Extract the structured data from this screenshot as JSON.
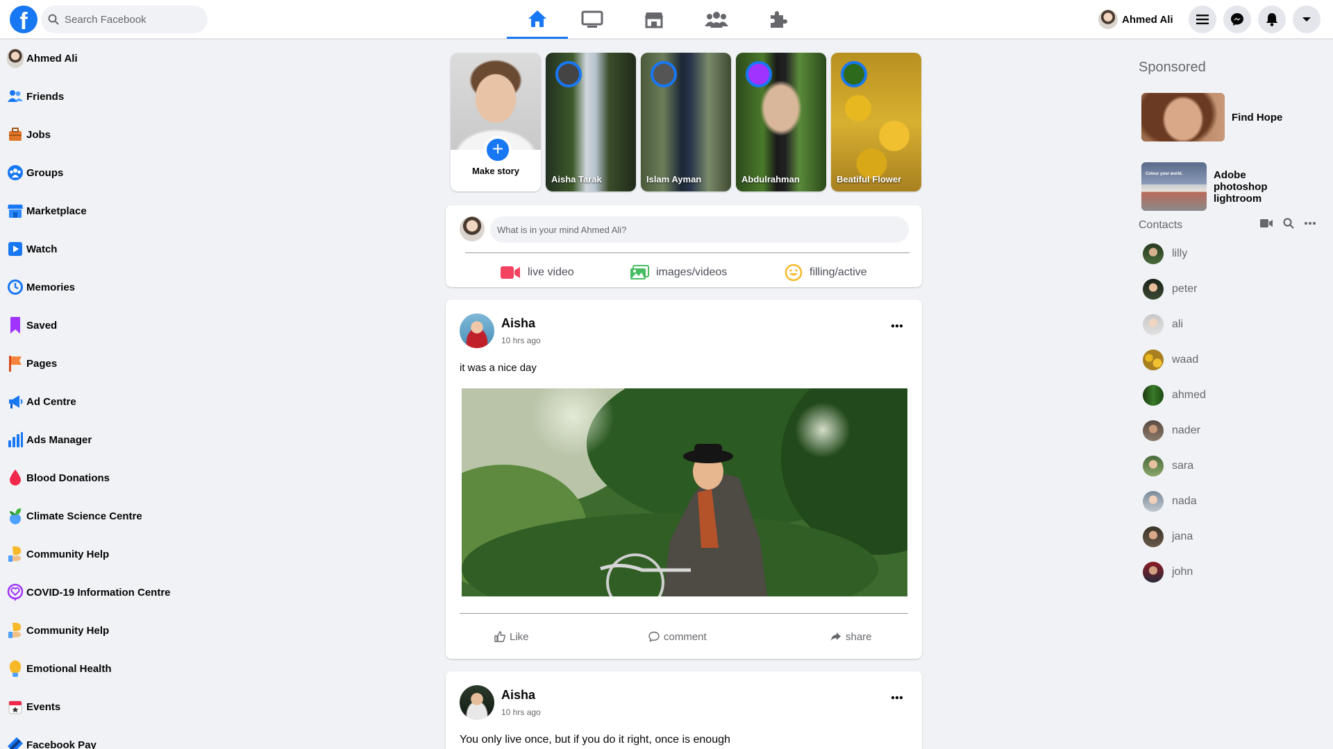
{
  "brand": {
    "logo_letter": "f",
    "color": "#1877f2"
  },
  "search": {
    "placeholder": "Search Facebook"
  },
  "nav_tabs": [
    {
      "icon": "home-icon",
      "active": true
    },
    {
      "icon": "watch-icon",
      "active": false
    },
    {
      "icon": "marketplace-icon",
      "active": false
    },
    {
      "icon": "groups-icon",
      "active": false
    },
    {
      "icon": "gaming-icon",
      "active": false
    }
  ],
  "user": {
    "name": "Ahmed Ali"
  },
  "header_buttons": [
    "menu-icon",
    "messenger-icon",
    "notifications-icon",
    "account-dropdown-icon"
  ],
  "left_menu": [
    {
      "label": "Ahmed Ali",
      "icon": "avatar"
    },
    {
      "label": "Friends",
      "icon": "friends-icon"
    },
    {
      "label": "Jobs",
      "icon": "jobs-icon"
    },
    {
      "label": "Groups",
      "icon": "groups-icon"
    },
    {
      "label": "Marketplace",
      "icon": "marketplace-icon"
    },
    {
      "label": "Watch",
      "icon": "watch-icon"
    },
    {
      "label": "Memories",
      "icon": "memories-icon"
    },
    {
      "label": "Saved",
      "icon": "saved-icon"
    },
    {
      "label": "Pages",
      "icon": "pages-icon"
    },
    {
      "label": "Ad Centre",
      "icon": "ad-centre-icon"
    },
    {
      "label": "Ads Manager",
      "icon": "ads-manager-icon"
    },
    {
      "label": "Blood Donations",
      "icon": "blood-donation-icon"
    },
    {
      "label": "Climate Science Centre",
      "icon": "climate-icon"
    },
    {
      "label": "Community Help",
      "icon": "community-help-icon"
    },
    {
      "label": "COVID-19 Information Centre",
      "icon": "covid-icon"
    },
    {
      "label": "Community Help",
      "icon": "community-help-icon"
    },
    {
      "label": "Emotional Health",
      "icon": "emotional-health-icon"
    },
    {
      "label": "Events",
      "icon": "events-icon"
    },
    {
      "label": "Facebook Pay",
      "icon": "facebook-pay-icon"
    }
  ],
  "stories": {
    "make_story_label": "Make story",
    "items": [
      {
        "name": "Aisha Tarak"
      },
      {
        "name": "Islam Ayman"
      },
      {
        "name": "Abdulrahman"
      },
      {
        "name": "Beatiful Flower"
      }
    ]
  },
  "composer": {
    "placeholder": "What is in your mind Ahmed Ali?",
    "actions": [
      {
        "label": "live video",
        "icon": "live-video-icon",
        "color": "#f3425f"
      },
      {
        "label": "images/videos",
        "icon": "photo-icon",
        "color": "#45bd62"
      },
      {
        "label": "filling/active",
        "icon": "feeling-icon",
        "color": "#f7b928"
      }
    ]
  },
  "posts": [
    {
      "author": "Aisha",
      "time": "10 hrs ago",
      "text": "it was a nice day"
    },
    {
      "author": "Aisha",
      "time": "10 hrs ago",
      "text": "You only live once, but if you do it right, once is enough"
    }
  ],
  "post_actions": {
    "like": "Like",
    "comment": "comment",
    "share": "share"
  },
  "sponsored": {
    "title": "Sponsored",
    "items": [
      {
        "name": "Find Hope"
      },
      {
        "name": "Adobe photoshop lightroom",
        "image_text": "Colour your world."
      }
    ]
  },
  "contacts": {
    "title": "Contacts",
    "items": [
      "lilly",
      "peter",
      "ali",
      "waad",
      "ahmed",
      "nader",
      "sara",
      "nada",
      "jana",
      "john"
    ]
  }
}
